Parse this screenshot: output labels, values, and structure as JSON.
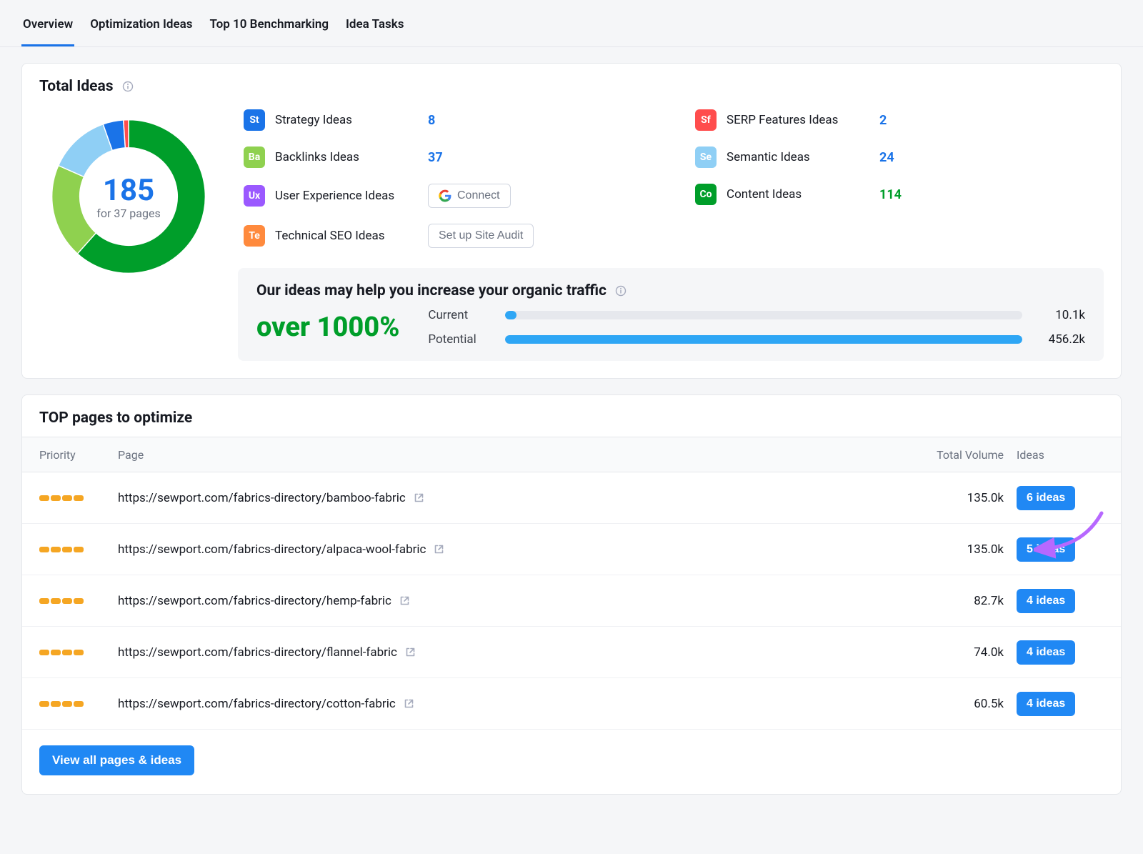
{
  "tabs": [
    {
      "label": "Overview",
      "active": true
    },
    {
      "label": "Optimization Ideas",
      "active": false
    },
    {
      "label": "Top 10 Benchmarking",
      "active": false
    },
    {
      "label": "Idea Tasks",
      "active": false
    }
  ],
  "totalIdeas": {
    "title": "Total Ideas",
    "count": "185",
    "sub": "for 37 pages",
    "categoriesLeft": [
      {
        "code": "St",
        "color": "#1a73e8",
        "label": "Strategy Ideas",
        "value": "8"
      },
      {
        "code": "Ba",
        "color": "#8fd14f",
        "label": "Backlinks Ideas",
        "value": "37"
      },
      {
        "code": "Ux",
        "color": "#9b59ff",
        "label": "User Experience Ideas",
        "value": ""
      },
      {
        "code": "Te",
        "color": "#ff8a3d",
        "label": "Technical SEO Ideas",
        "value": ""
      }
    ],
    "categoriesRight": [
      {
        "code": "Sf",
        "color": "#ff4d4d",
        "label": "SERP Features Ideas",
        "value": "2"
      },
      {
        "code": "Se",
        "color": "#8fcff5",
        "label": "Semantic Ideas",
        "value": "24"
      },
      {
        "code": "Co",
        "color": "#009e2a",
        "label": "Content Ideas",
        "value": "114"
      }
    ],
    "connectLabel": "Connect",
    "siteAuditLabel": "Set up Site Audit"
  },
  "trafficPanel": {
    "title": "Our ideas may help you increase your organic traffic",
    "percent": "over 1000%",
    "currentLabel": "Current",
    "currentValue": "10.1k",
    "currentPct": 2.2,
    "potentialLabel": "Potential",
    "potentialValue": "456.2k",
    "potentialPct": 100
  },
  "topPages": {
    "title": "TOP pages to optimize",
    "headers": {
      "priority": "Priority",
      "page": "Page",
      "volume": "Total Volume",
      "ideas": "Ideas"
    },
    "rows": [
      {
        "url": "https://sewport.com/fabrics-directory/bamboo-fabric",
        "volume": "135.0k",
        "ideas": "6 ideas"
      },
      {
        "url": "https://sewport.com/fabrics-directory/alpaca-wool-fabric",
        "volume": "135.0k",
        "ideas": "5 ideas"
      },
      {
        "url": "https://sewport.com/fabrics-directory/hemp-fabric",
        "volume": "82.7k",
        "ideas": "4 ideas"
      },
      {
        "url": "https://sewport.com/fabrics-directory/flannel-fabric",
        "volume": "74.0k",
        "ideas": "4 ideas"
      },
      {
        "url": "https://sewport.com/fabrics-directory/cotton-fabric",
        "volume": "60.5k",
        "ideas": "4 ideas"
      }
    ],
    "viewAllLabel": "View all pages & ideas"
  },
  "chart_data": {
    "type": "pie",
    "title": "Total Ideas",
    "total": 185,
    "series": [
      {
        "name": "Content Ideas",
        "value": 114,
        "color": "#009e2a"
      },
      {
        "name": "Backlinks Ideas",
        "value": 37,
        "color": "#8fd14f"
      },
      {
        "name": "Semantic Ideas",
        "value": 24,
        "color": "#8fcff5"
      },
      {
        "name": "Strategy Ideas",
        "value": 8,
        "color": "#1a73e8"
      },
      {
        "name": "SERP Features Ideas",
        "value": 2,
        "color": "#ff4d4d"
      }
    ]
  }
}
